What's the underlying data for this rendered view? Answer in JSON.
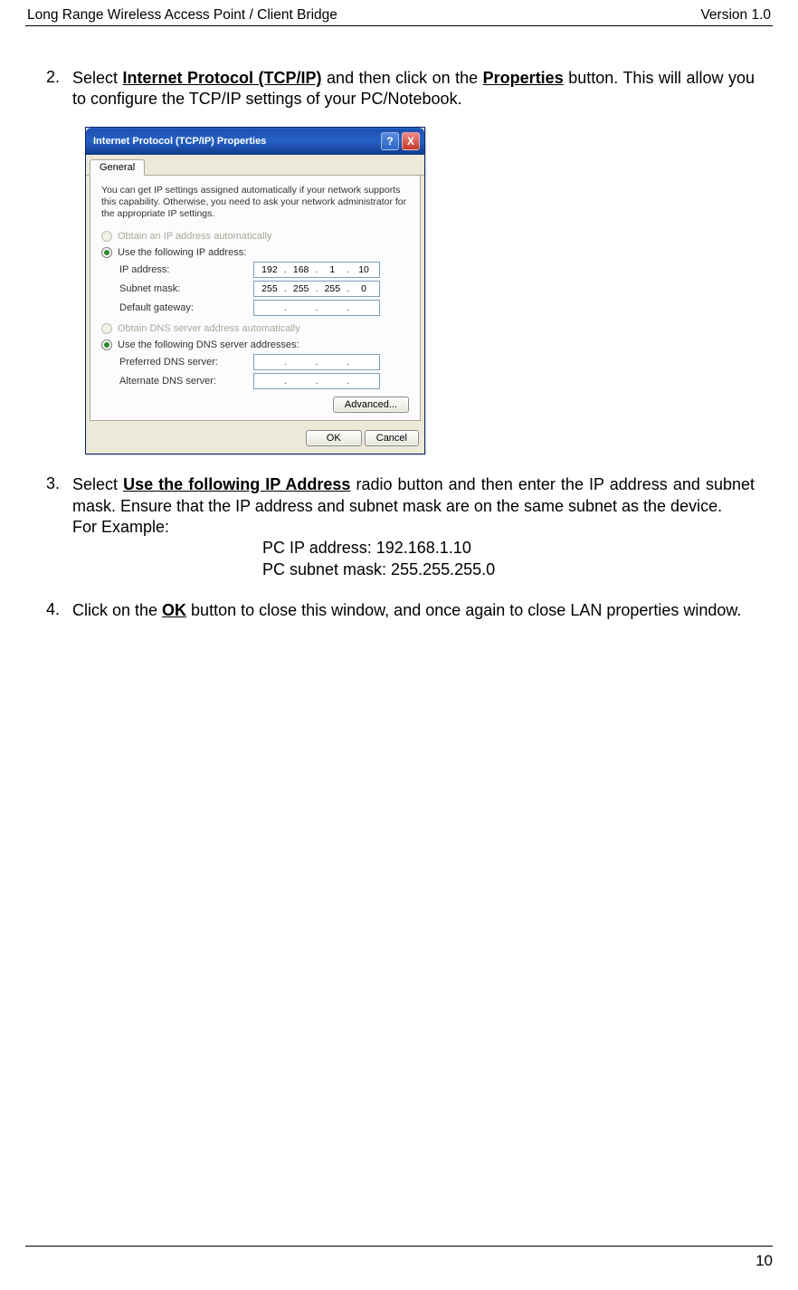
{
  "header": {
    "left": "Long Range Wireless Access Point / Client Bridge",
    "right": "Version 1.0"
  },
  "step2": {
    "num": "2.",
    "t1": "Select ",
    "b1": "Internet Protocol (TCP/IP)",
    "t2": " and then click on the ",
    "b2": "Properties",
    "t3": " button. This will allow you to configure the TCP/IP settings of your PC/Notebook."
  },
  "dialog": {
    "title": "Internet Protocol (TCP/IP) Properties",
    "help": "?",
    "close": "X",
    "tab": "General",
    "desc": "You can get IP settings assigned automatically if your network supports this capability. Otherwise, you need to ask your network administrator for the appropriate IP settings.",
    "r_auto_ip": "Obtain an IP address automatically",
    "r_use_ip": "Use the following IP address:",
    "lbl_ip": "IP address:",
    "lbl_sub": "Subnet mask:",
    "lbl_gw": "Default gateway:",
    "ip": {
      "a": "192",
      "b": "168",
      "c": "1",
      "d": "10"
    },
    "sub": {
      "a": "255",
      "b": "255",
      "c": "255",
      "d": "0"
    },
    "gw": {
      "a": " ",
      "b": " ",
      "c": " ",
      "d": " "
    },
    "r_auto_dns": "Obtain DNS server address automatically",
    "r_use_dns": "Use the following DNS server addresses:",
    "lbl_pdns": "Preferred DNS server:",
    "lbl_adns": "Alternate DNS server:",
    "btn_adv": "Advanced...",
    "btn_ok": "OK",
    "btn_cancel": "Cancel"
  },
  "step3": {
    "num": "3.",
    "t1": "Select ",
    "b1": "Use the following IP Address",
    "t2": " radio button and then enter the IP address and subnet mask. Ensure that the IP address and subnet mask are on the same subnet as the device.",
    "forex": "For Example:",
    "line1": "PC IP address: 192.168.1.10",
    "line2": "PC subnet mask: 255.255.255.0"
  },
  "step4": {
    "num": "4.",
    "t1": "Click on the ",
    "b1": "OK",
    "t2": " button to close this window, and once again to close LAN properties window."
  },
  "footer": {
    "page": "10"
  }
}
